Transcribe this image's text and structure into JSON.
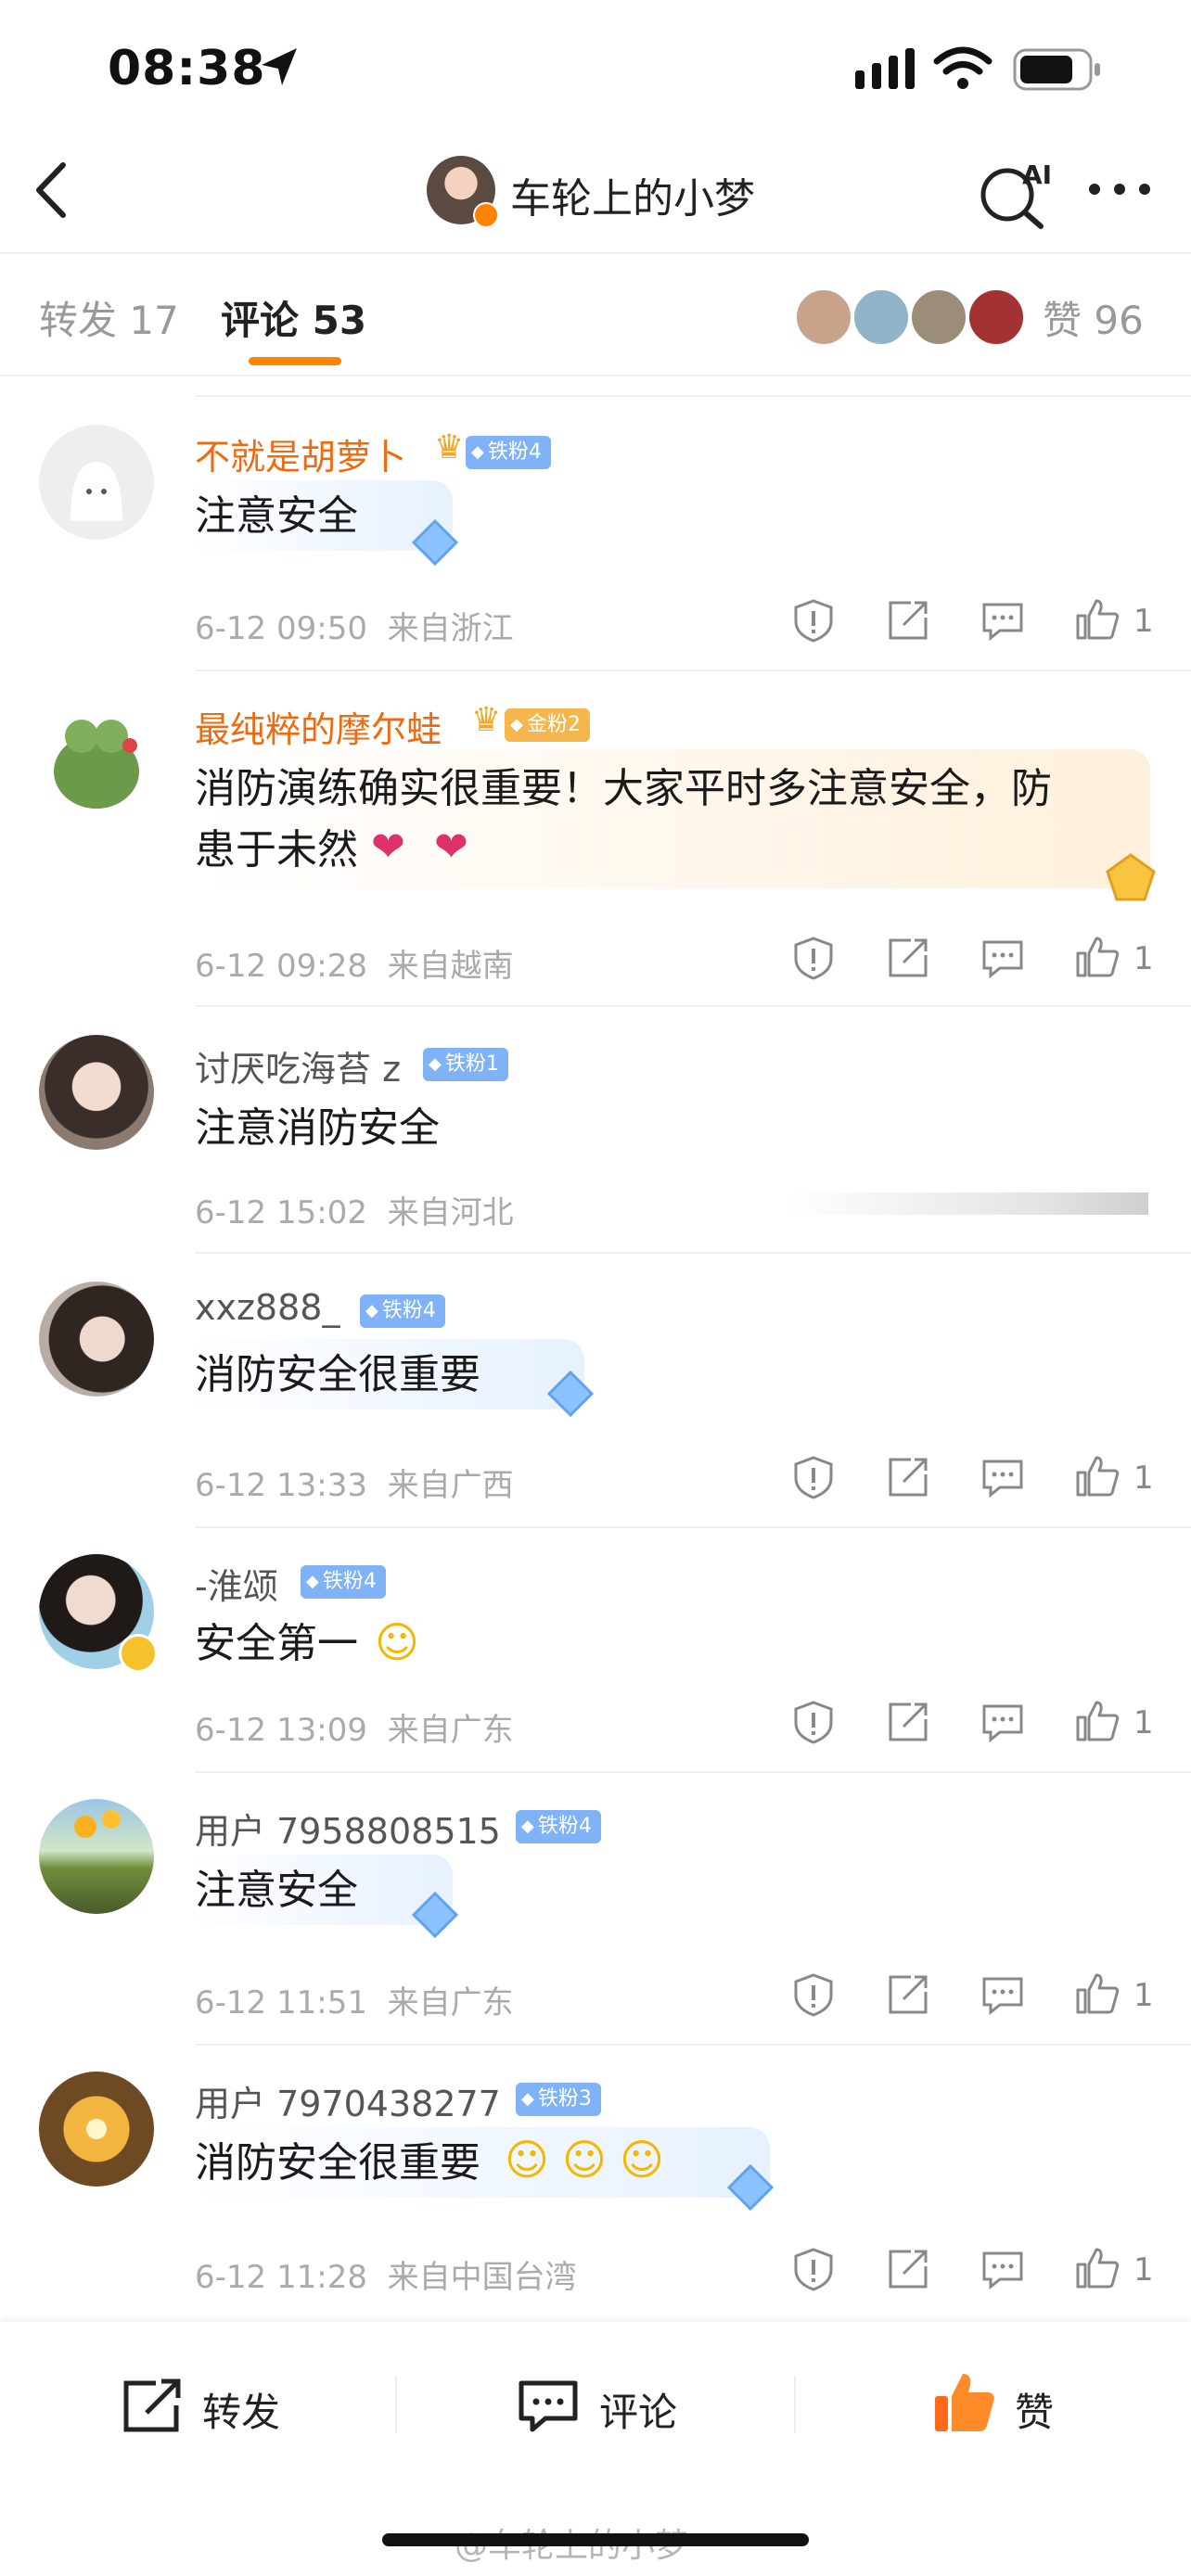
{
  "status_bar": {
    "time": "08:38"
  },
  "nav": {
    "title": "车轮上的小梦"
  },
  "tabs": {
    "repost": "转发 17",
    "comment": "评论 53",
    "like": "赞 96"
  },
  "comments": [
    {
      "name": "不就是胡萝卜",
      "badge": "铁粉4",
      "text": "注意安全",
      "date": "6-12 09:50",
      "location": "来自浙江",
      "likes": "1"
    },
    {
      "name": "最纯粹的摩尔蛙",
      "badge": "金粉2",
      "text": "消防演练确实很重要！大家平时多注意安全，防",
      "text2": "患于未然",
      "date": "6-12 09:28",
      "location": "来自越南",
      "likes": "1"
    },
    {
      "name": "讨厌吃海苔 z",
      "badge": "铁粉1",
      "text": "注意消防安全",
      "date": "6-12 15:02",
      "location": "来自河北",
      "likes": ""
    },
    {
      "name": "xxz888_",
      "badge": "铁粉4",
      "text": "消防安全很重要",
      "date": "6-12 13:33",
      "location": "来自广西",
      "likes": "1"
    },
    {
      "name": "-淮颂",
      "badge": "铁粉4",
      "text": "安全第一",
      "date": "6-12 13:09",
      "location": "来自广东",
      "likes": "1"
    },
    {
      "name": "用户 7958808515",
      "badge": "铁粉4",
      "text": "注意安全",
      "date": "6-12 11:51",
      "location": "来自广东",
      "likes": "1"
    },
    {
      "name": "用户 7970438277",
      "badge": "铁粉3",
      "text": "消防安全很重要",
      "date": "6-12 11:28",
      "location": "来自中国台湾",
      "likes": "1"
    }
  ],
  "bottom_bar": {
    "repost": "转发",
    "comment": "评论",
    "like": "赞"
  },
  "watermark": "@车轮上的小梦",
  "colors": {
    "accent": "#ff8200",
    "name_orange": "#ee6a10",
    "badge_blue": "#7fb2f6",
    "badge_gold": "#f6b64e"
  }
}
